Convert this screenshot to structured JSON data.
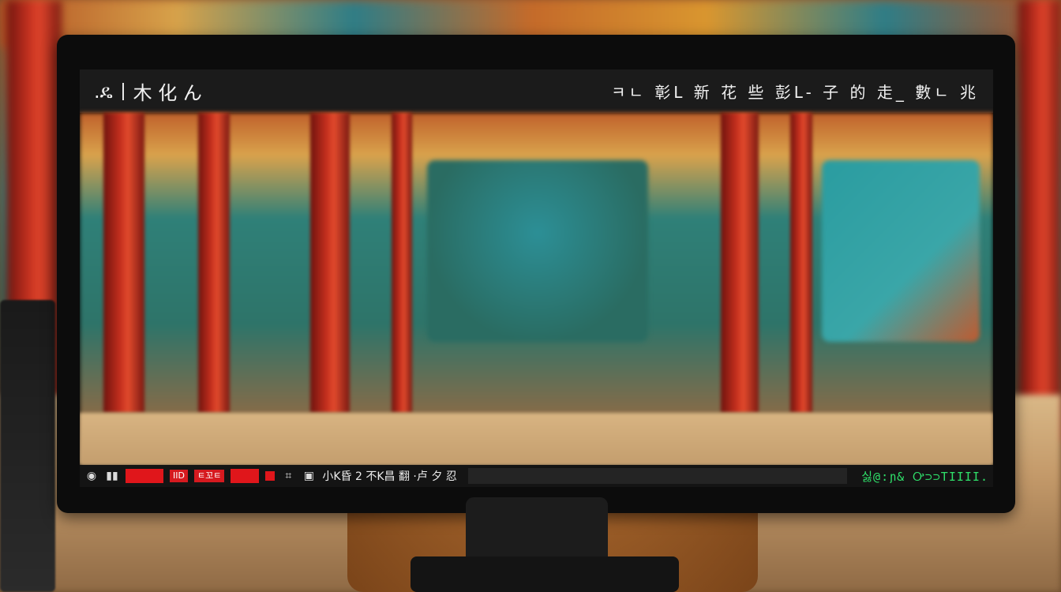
{
  "viewer": {
    "brand": ".ዴ",
    "title": "木 化 ん",
    "menu": "ㅋㄴ 彰L 新 花 些 彭L- 子 的 走_ 數ㄴ 兆"
  },
  "status": {
    "rec_label": "IID",
    "mode_label": "ㅌ꼬ㅌ",
    "info": "小K昏 2 不K昌 翻 ·卢 夕 忍",
    "timecode": "싫@:ɲ& Ꭴ⊃⊃ΤIIII."
  }
}
